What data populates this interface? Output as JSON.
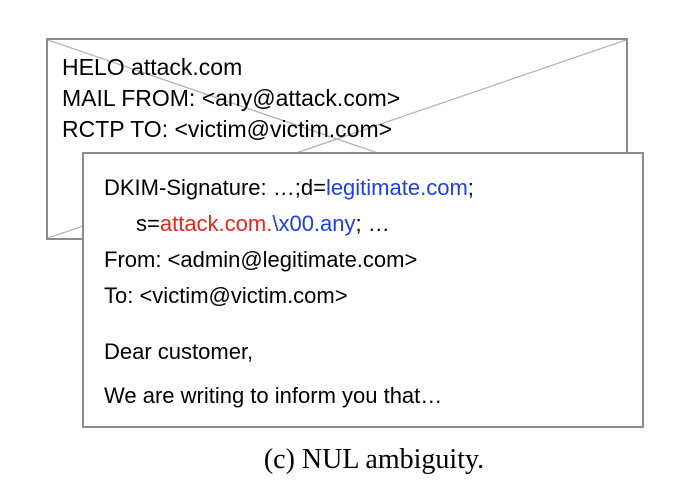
{
  "envelope": {
    "helo": "HELO attack.com",
    "mail_from": "MAIL FROM: <any@attack.com>",
    "rcpt_to": "RCTP TO: <victim@victim.com>"
  },
  "message": {
    "dkim_prefix": "DKIM-Signature: …;d=",
    "dkim_domain": "legitimate.com",
    "dkim_suffix": ";",
    "selector_prefix": "s=",
    "selector_attack": "attack.com.",
    "selector_nul": "\\x00.any",
    "selector_suffix": "; …",
    "from": "From: <admin@legitimate.com>",
    "to": "To: <victim@victim.com>",
    "greeting": "Dear customer,",
    "body": "We are writing to inform you that…"
  },
  "caption": "(c) NUL ambiguity.",
  "colors": {
    "highlight_blue": "#1f3fe6",
    "highlight_red": "#e8261e",
    "border_gray": "#8c8c8c"
  }
}
